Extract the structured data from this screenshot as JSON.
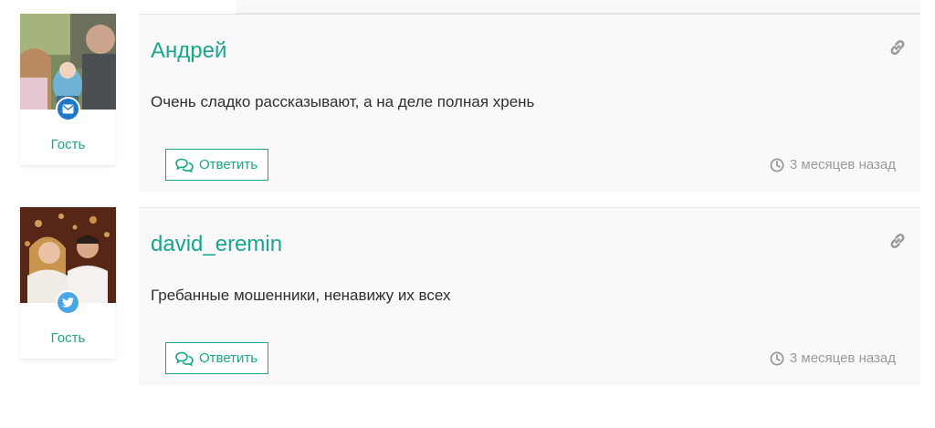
{
  "comments": [
    {
      "author": "Андрей",
      "role": "Гость",
      "text": "Очень сладко рассказывают, а на деле полная хрень",
      "reply_label": "Ответить",
      "time": "3 месяцев назад",
      "social": "mail-icon",
      "badge_color": "#1f77c9"
    },
    {
      "author": "david_eremin",
      "role": "Гость",
      "text": "Гребанные мошенники, ненавижу их всех",
      "reply_label": "Ответить",
      "time": "3 месяцев назад",
      "social": "twitter-icon",
      "badge_color": "#4ba6e8"
    }
  ],
  "colors": {
    "accent": "#19a68a",
    "text": "#2f2f2f",
    "muted": "#9a9a9a",
    "card_bg": "#f9f9f9"
  }
}
